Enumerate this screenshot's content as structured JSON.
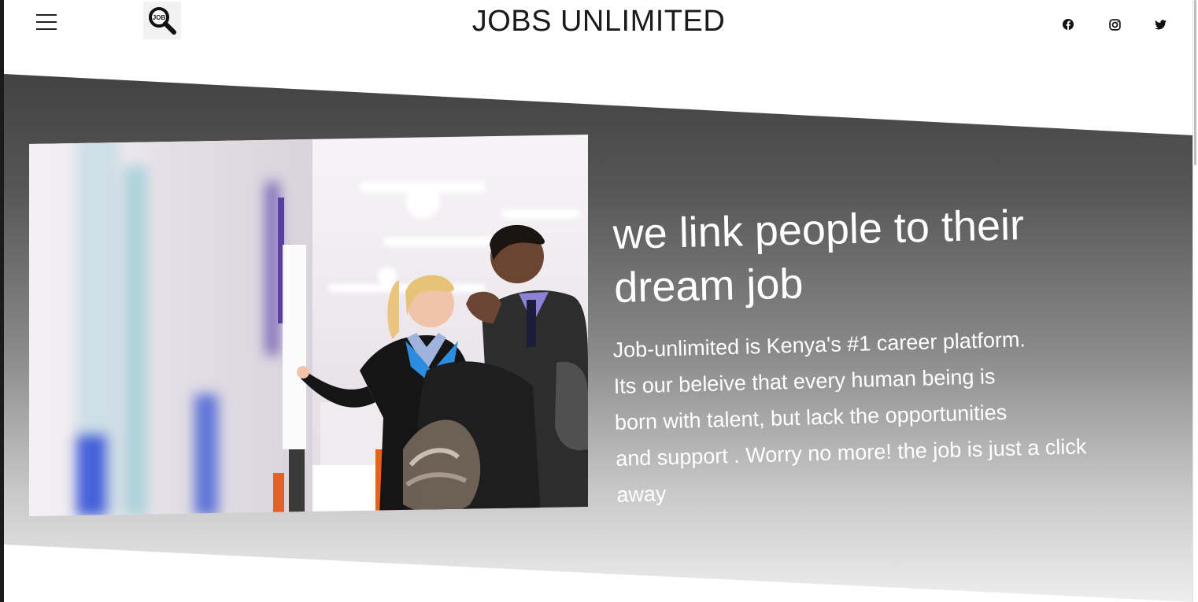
{
  "header": {
    "title": "JOBS UNLIMITED",
    "logo_text": "JOB",
    "menu_icon": "hamburger-menu-icon",
    "social": [
      {
        "name": "facebook",
        "icon": "facebook-icon"
      },
      {
        "name": "instagram",
        "icon": "instagram-icon"
      },
      {
        "name": "twitter",
        "icon": "twitter-icon"
      }
    ]
  },
  "hero": {
    "headline": "we link people to their dream job",
    "description_lines": [
      "Job-unlimited is Kenya's #1 career platform.",
      "Its our beleive that every human being is",
      "born with talent, but lack the opportunities",
      "and support . Worry no more! the job is just a click",
      "away"
    ]
  },
  "colors": {
    "band_top": "#3e3e3e",
    "band_bottom": "#eeeeee",
    "text_light": "#ffffff",
    "header_text": "#1a1a1a"
  }
}
